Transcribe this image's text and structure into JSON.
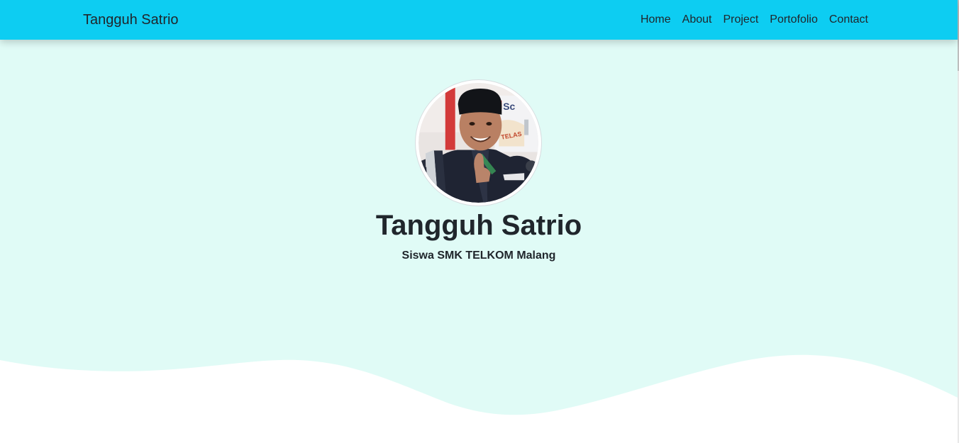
{
  "navbar": {
    "brand": "Tangguh Satrio",
    "links": [
      "Home",
      "About",
      "Project",
      "Portofolio",
      "Contact"
    ]
  },
  "hero": {
    "title": "Tangguh Satrio",
    "subtitle": "Siswa SMK TELKOM Malang",
    "avatar_icon": "profile-photo-icon"
  },
  "colors": {
    "navbar_bg": "#0dcdf2",
    "hero_bg": "#e0fbf6",
    "text": "#20262c",
    "wave": "#ffffff"
  }
}
